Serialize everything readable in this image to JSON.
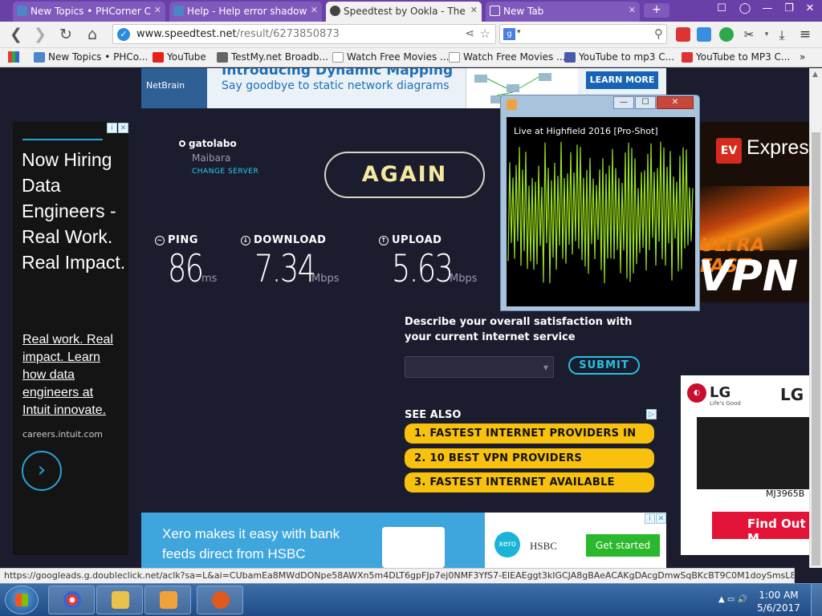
{
  "browser": {
    "tabs": [
      {
        "label": "New Topics • PHCorner C",
        "active": false
      },
      {
        "label": "Help - Help error shadow",
        "active": false
      },
      {
        "label": "Speedtest by Ookla - The",
        "active": true
      },
      {
        "label": "New Tab",
        "active": false
      }
    ],
    "url_host": "www.speedtest.net",
    "url_path": "/result/6273850873",
    "search_engine": "g",
    "bookmarks": [
      "New Topics • PHCo...",
      "YouTube",
      "TestMy.net Broadb...",
      "Watch Free Movies ...",
      "Watch Free Movies ...",
      "YouTube to mp3 C...",
      "YouTube to MP3 C..."
    ],
    "more_bookmarks": "»",
    "status_url": "https://googleads.g.doubleclick.net/aclk?sa=L&ai=CUbamEa8MWdDONpe58AWXn5m4DLT6gpFJp7ej0NMF3YfS7-EIEAEggt3kIGCJA8gBAeACAKgDAcgDmwSqBKcBT9C0M1doySmsL8P..."
  },
  "speedtest": {
    "isp": "gatolabo",
    "server": "Maibara",
    "change_server": "CHANGE SERVER",
    "again": "AGAIN",
    "ping": {
      "label": "PING",
      "value": "86",
      "unit": "ms"
    },
    "download": {
      "label": "DOWNLOAD",
      "value": "7.34",
      "unit": "Mbps"
    },
    "upload": {
      "label": "UPLOAD",
      "value": "5.63",
      "unit": "Mbps"
    },
    "satisfaction_question": "Describe your overall satisfaction with your current internet service",
    "submit": "SUBMIT",
    "see_also": "SEE ALSO",
    "see_also_items": [
      "1.  FASTEST INTERNET PROVIDERS IN",
      "2.  10 BEST VPN PROVIDERS",
      "3.  FASTEST INTERNET AVAILABLE"
    ]
  },
  "ads": {
    "top_logo": "NetBrain",
    "top_title": "Introducing Dynamic Mapping",
    "top_subtitle": "Say goodbye to static network diagrams",
    "top_cta": "LEARN MORE",
    "left_headline": "Now Hiring Data Engineers - Real Work. Real Impact.",
    "left_body": "Real work. Real impact. Learn how data engineers at Intuit innovate.",
    "left_domain": "careers.intuit.com",
    "bottom_text": "Xero makes it easy with bank feeds direct from HSBC",
    "bottom_xero": "xero",
    "bottom_hsbc": "HSBC",
    "bottom_cta": "Get started",
    "vpn_logo": "EV",
    "vpn_brand": "Expres",
    "vpn_tag": "ULTRA FAST",
    "vpn_big": "VPN",
    "lg_logo": "LG",
    "lg_sub": "Life's Good",
    "lg_brand": "LG",
    "lg_model": "MJ3965B",
    "lg_cta": "Find Out M"
  },
  "popup": {
    "title": "Live at Highfield 2016 [Pro-Shot]",
    "waveform_color": "#9be01f"
  },
  "taskbar": {
    "time": "1:00 AM",
    "date": "5/6/2017"
  },
  "colors": {
    "page_bg": "#1b1c2e",
    "accent_cyan": "#26c1e4",
    "again_text": "#f4e89f",
    "see_also_bg": "#f7c10d",
    "chrome_frame": "#6a3fa8"
  }
}
